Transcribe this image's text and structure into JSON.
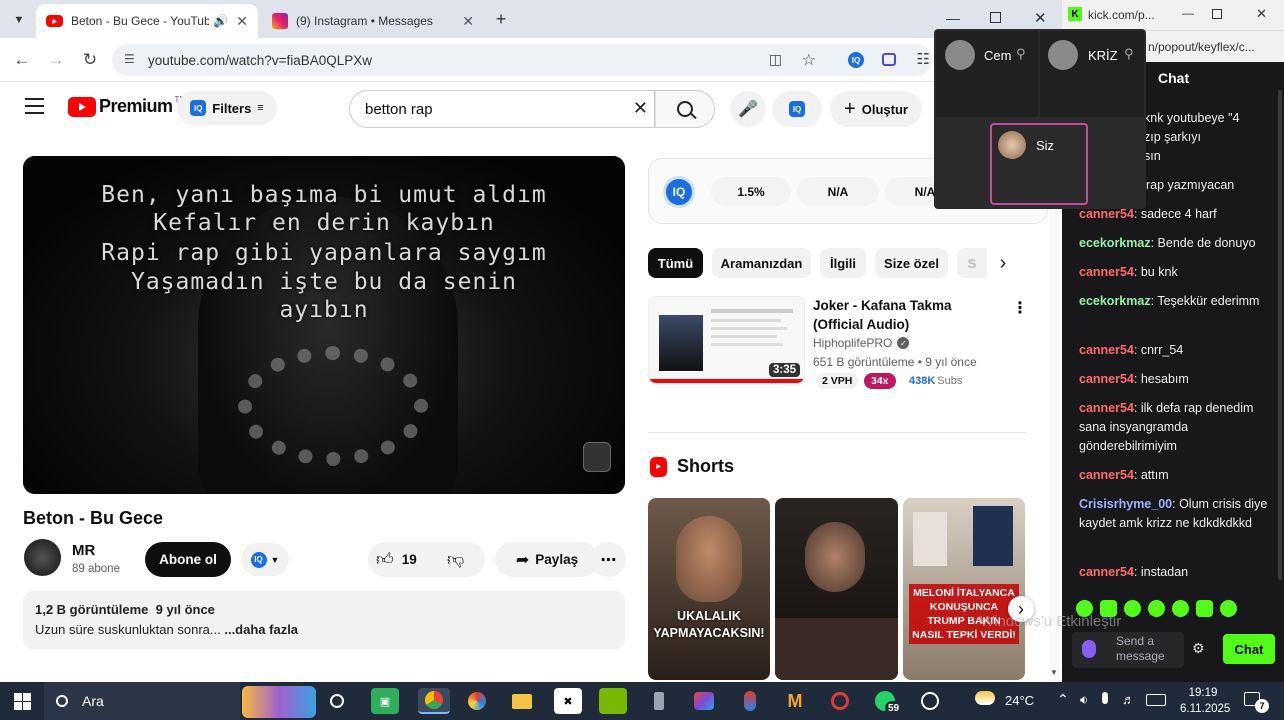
{
  "browser": {
    "tabs": [
      {
        "title": "Beton - Bu Gece - YouTube",
        "active": true
      },
      {
        "title": "(9) Instagram • Messages",
        "active": false
      }
    ],
    "url": "youtube.com/watch?v=fiaBA0QLPXw"
  },
  "youtube": {
    "logo_text": "Premium",
    "logo_sup": "TR",
    "filters_label": "Filters",
    "iq_badge": "IQ",
    "search_value": "betton rap",
    "create_label": "Oluştur",
    "video": {
      "title": "Beton - Bu Gece",
      "lyrics": [
        "Ben, yanı başıma bi umut aldım",
        "Kefalır en derin kaybın",
        "Rapi rap gibi yapanlara saygım",
        "Yaşamadın işte bu da senin",
        "ayıbın"
      ],
      "channel": "MR",
      "subscribers": "89 abone",
      "subscribe_label": "Abone ol",
      "likes": "19",
      "share_label": "Paylaş",
      "views": "1,2 B görüntüleme",
      "age": "9 yıl önce",
      "description": "Uzun süre suskunluktan sonra...",
      "more_label": "...daha fazla"
    },
    "iq_stats": [
      "1.5%",
      "N/A",
      "N/A"
    ],
    "chips": [
      "Tümü",
      "Aramanızdan",
      "İlgili",
      "Size özel",
      "S"
    ],
    "recommended": {
      "title": "Joker - Kafana Takma (Official Audio)",
      "channel": "HiphoplifePRO",
      "meta": "651 B görüntüleme • 9 yıl önce",
      "duration": "3:35",
      "vph": "2 VPH",
      "multiplier": "34x",
      "subs_value": "438K",
      "subs_label": "Subs"
    },
    "shorts_label": "Shorts",
    "shorts": [
      {
        "caption": "UKALALIK YAPMAYACAKSIN!"
      },
      {
        "caption": ""
      },
      {
        "caption": "MELONİ İTALYANCA KONUŞUNCA TRUMP BAKIN NASIL TEPKİ VERDİ!"
      }
    ]
  },
  "call": {
    "participants": [
      "Cem",
      "KRİZ",
      "Siz"
    ]
  },
  "kick": {
    "title": "kick.com/p...",
    "url_fragment": "n/popout/keyflex/c...",
    "chat_header": "Chat",
    "messages": [
      {
        "user": "",
        "text": "knk youtubeye \"4"
      },
      {
        "user": "",
        "text": "zıp şarkıyı"
      },
      {
        "user": "",
        "text": "sın"
      },
      {
        "user": "",
        "text": "rap yazmıyacan"
      },
      {
        "user": "canner54",
        "text": "sadece 4 harf"
      },
      {
        "user": "ecekorkmaz",
        "text": "Bende de donuyo"
      },
      {
        "user": "canner54",
        "text": "bu knk"
      },
      {
        "user": "ecekorkmaz",
        "text": "Teşekkür ederimm"
      },
      {
        "user": "canner54",
        "text": "cnrr_54"
      },
      {
        "user": "canner54",
        "text": "hesabım"
      },
      {
        "user": "canner54",
        "text": "ilk defa rap denedim sana insyangramda gönderebilrimiyim"
      },
      {
        "user": "canner54",
        "text": "attım"
      },
      {
        "user": "Crisisrhyme_00",
        "text": "Olum crisis diye kaydet amk krizz ne kdkdkdkkd"
      },
      {
        "user": "canner54",
        "text": "instadan"
      }
    ],
    "send_placeholder": "Send a message",
    "chat_button": "Chat",
    "overlay_text": "Windows'u Etkinleştir"
  },
  "taskbar": {
    "search_label": "Ara",
    "whatsapp_badge": "59",
    "temperature": "24°C",
    "time": "19:19",
    "date": "6.11.2025",
    "notification_count": "7"
  },
  "colors": {
    "yt_red": "#ff0000",
    "kick_green": "#53fc18",
    "chat_red_user": "#ff6b6b",
    "chat_green_user": "#8ff0a4",
    "chat_blue_user": "#9ab4ff"
  }
}
